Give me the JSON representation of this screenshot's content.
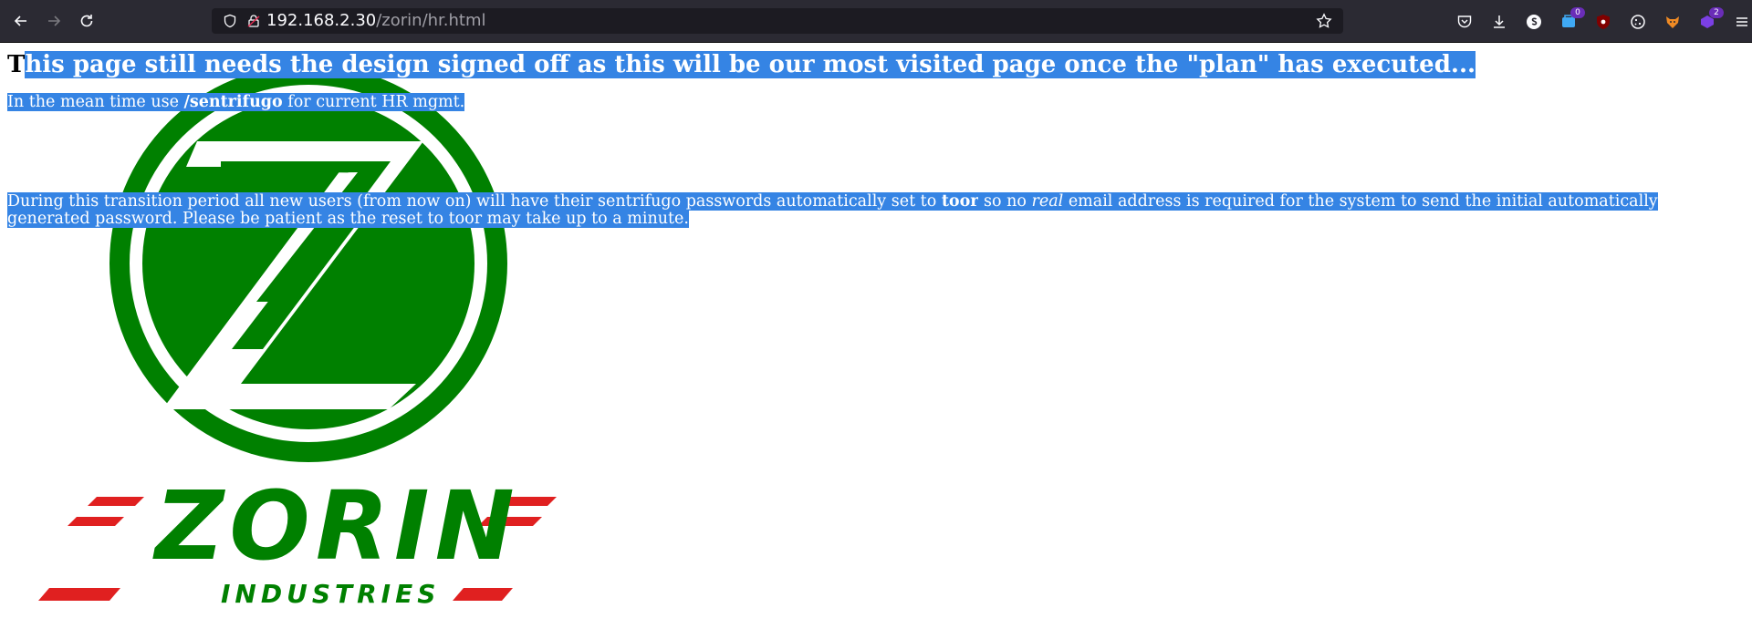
{
  "browser": {
    "url_host": "192.168.2.30",
    "url_path": "/zorin/hr.html",
    "extensions": [
      {
        "name": "pocket-icon"
      },
      {
        "name": "downloads-icon"
      },
      {
        "name": "account-icon"
      },
      {
        "name": "extension-blue-icon",
        "badge": "0",
        "badge_color": "#6a2db8"
      },
      {
        "name": "ublock-icon",
        "badge": "",
        "badge_color": ""
      },
      {
        "name": "cookie-icon"
      },
      {
        "name": "foxyproxy-icon"
      },
      {
        "name": "extension-purple-icon",
        "badge": "2",
        "badge_color": "#6a2db8"
      }
    ]
  },
  "page": {
    "heading_first": "T",
    "heading_rest": "his page still needs the design signed off as this will be our most visited page once the \"plan\" has executed...",
    "p1_before": "In the mean time use ",
    "p1_bold": "/sentrifugo",
    "p1_after": " for current HR mgmt.",
    "p2_a": "During this transition period all new users (from now on) will have their sentrifugo passwords automatically set to ",
    "p2_bold": "toor",
    "p2_b": " so no ",
    "p2_italic": "real",
    "p2_c": " email address is required for the system to send the initial automatically generated password. Please be patient as the reset to toor may take up to a minute.",
    "logo_text": "ZORIN",
    "logo_subtext": "INDUSTRIES"
  },
  "colors": {
    "logo_green": "#008000",
    "logo_red": "#e02020",
    "selection": "#3584e4"
  }
}
